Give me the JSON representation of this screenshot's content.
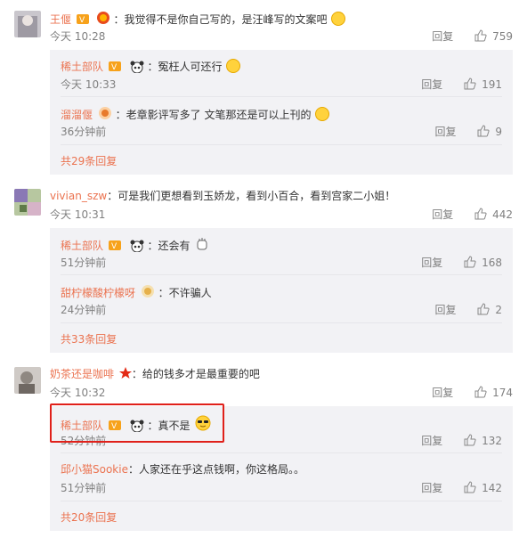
{
  "reply_label": "回复",
  "comments": [
    {
      "user": "王偃",
      "text": "：我觉得不是你自己写的，是汪峰写的文案吧",
      "time": "今天 10:28",
      "likes": "759",
      "replies": [
        {
          "user": "稀土部队",
          "text": "：冤枉人可还行",
          "time": "今天 10:33",
          "likes": "191"
        },
        {
          "user": "溜溜偃",
          "text": "：老章影评写多了 文笔那还是可以上刊的",
          "time": "36分钟前",
          "likes": "9"
        }
      ],
      "more": "共29条回复"
    },
    {
      "user": "vivian_szw",
      "text": "：可是我们更想看到玉娇龙，看到小百合，看到宫家二小姐！",
      "time": "今天 10:31",
      "likes": "442",
      "replies": [
        {
          "user": "稀土部队",
          "text": "：还会有",
          "time": "51分钟前",
          "likes": "168"
        },
        {
          "user": "甜柠檬酸柠檬呀",
          "text": "：不许骗人",
          "time": "24分钟前",
          "likes": "2"
        }
      ],
      "more": "共33条回复"
    },
    {
      "user": "奶茶还是咖啡",
      "text": "：给的钱多才是最重要的吧",
      "time": "今天 10:32",
      "likes": "174",
      "replies": [
        {
          "user": "稀土部队",
          "text": "：真不是",
          "time": "52分钟前",
          "likes": "132"
        },
        {
          "user": "邱小猫Sookie",
          "text": "：人家还在乎这点钱啊，你这格局。。",
          "time": "51分钟前",
          "likes": "142"
        }
      ],
      "more": "共20条回复"
    }
  ],
  "colors": {
    "username": "#eb7350",
    "meta": "#808080",
    "reply_bg": "#f2f2f5",
    "highlight": "#e0201a"
  }
}
